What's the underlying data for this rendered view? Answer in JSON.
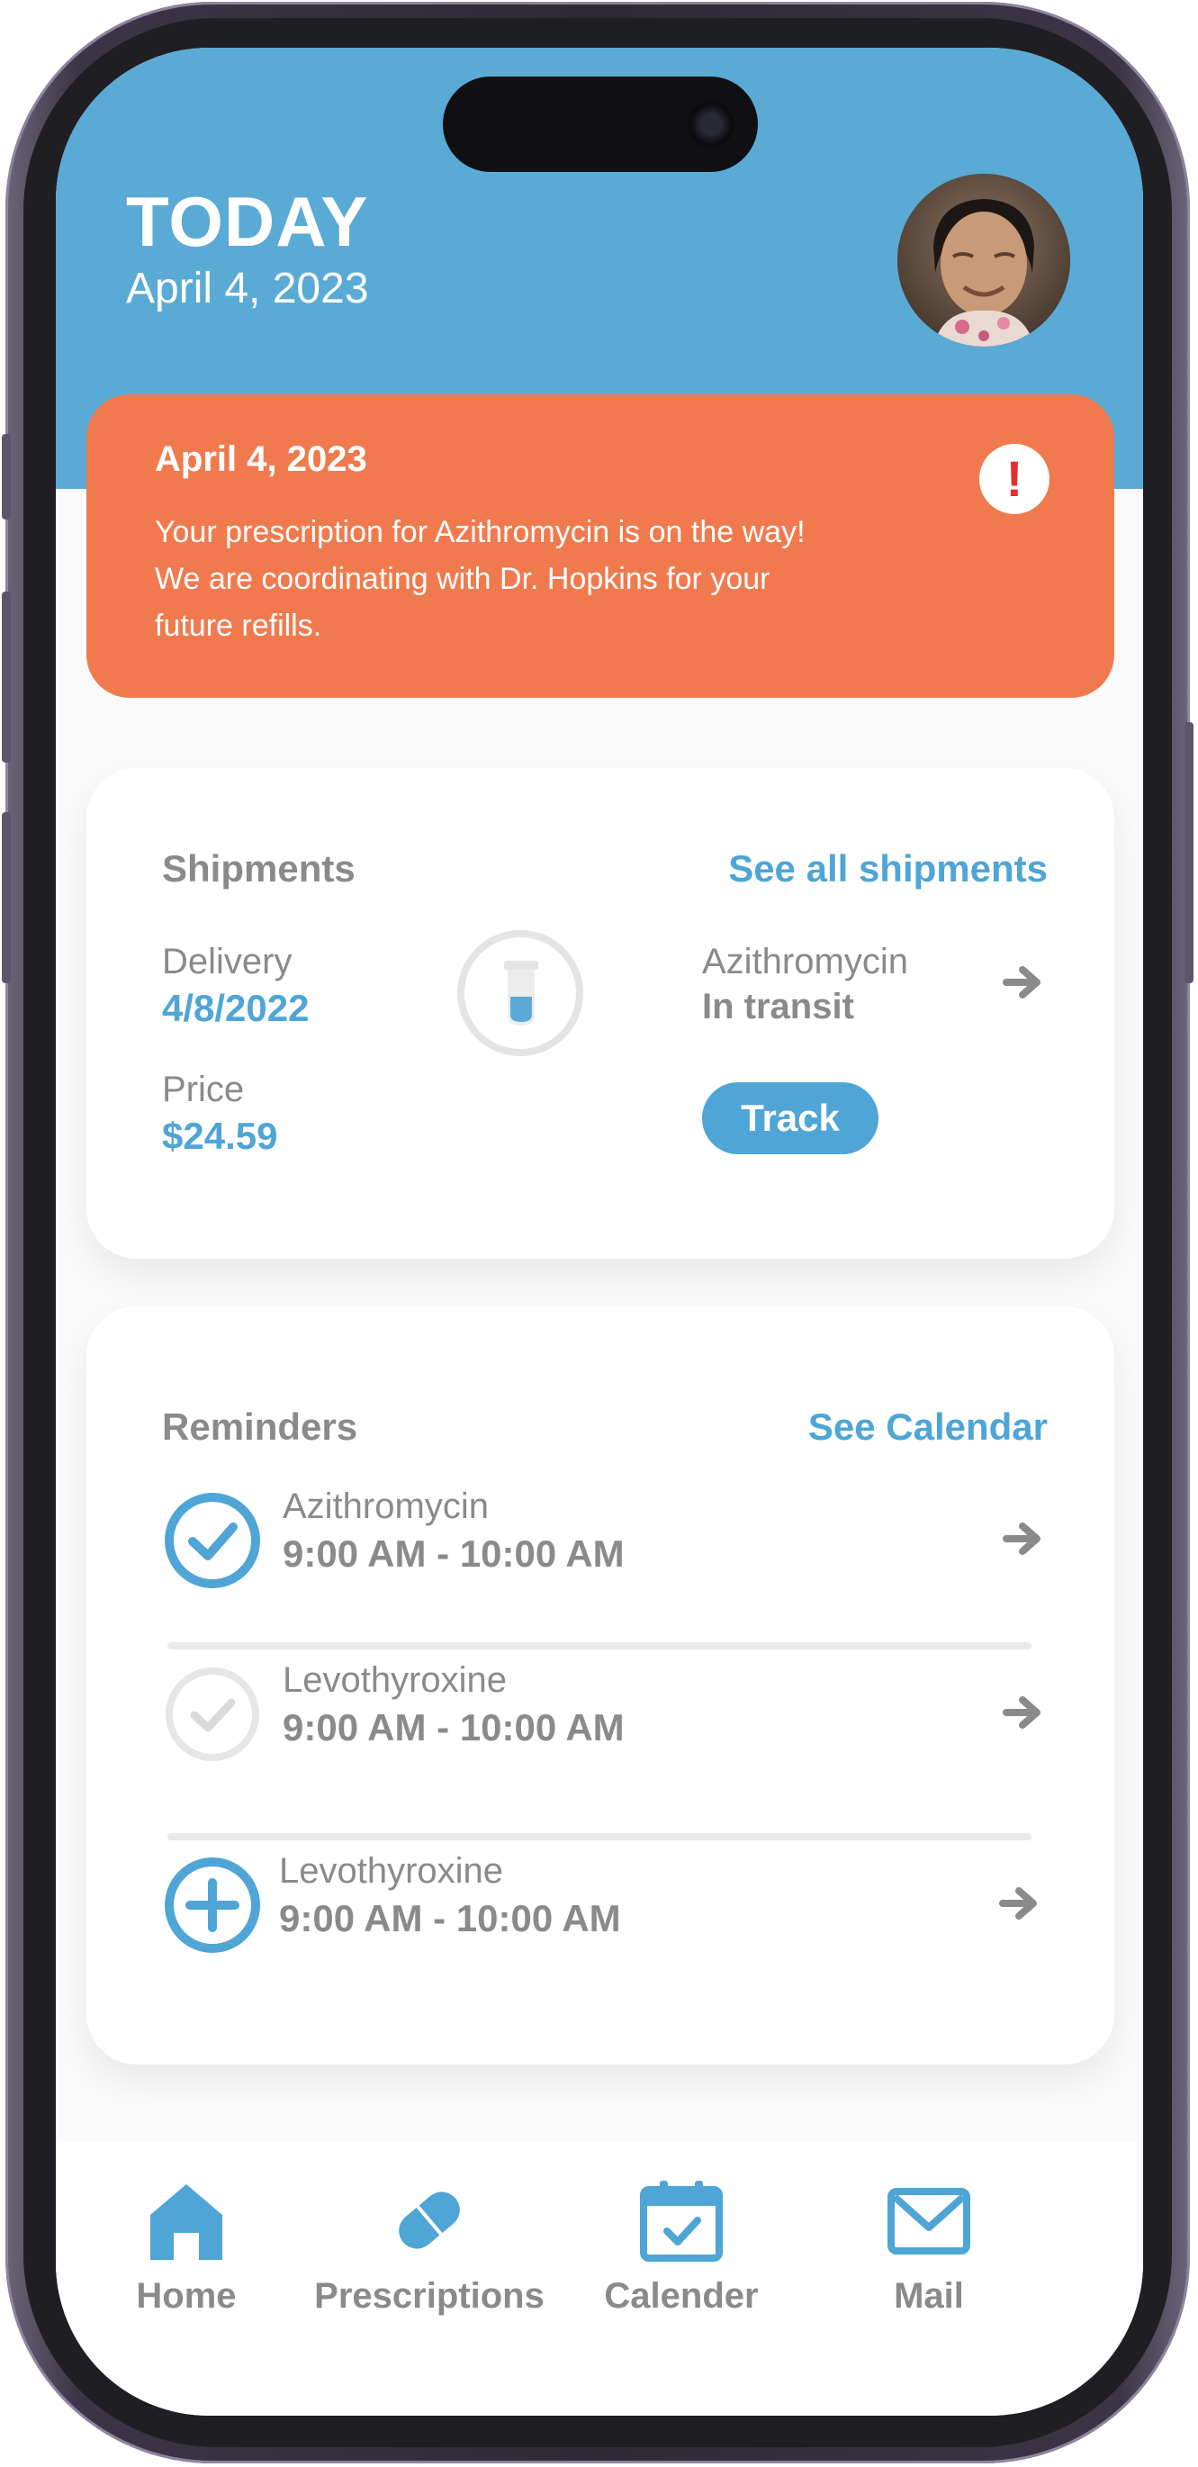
{
  "header": {
    "title": "TODAY",
    "date": "April 4, 2023"
  },
  "alert": {
    "date": "April 4, 2023",
    "message_line1": "Your prescription for Azithromycin is on the way!",
    "message_line2": "We are coordinating with Dr. Hopkins for your",
    "message_line3": "future refills.",
    "icon": "exclamation-icon",
    "color": "#f07a4e"
  },
  "shipments": {
    "title": "Shipments",
    "see_all": "See all shipments",
    "delivery_label": "Delivery",
    "delivery_value": "4/8/2022",
    "price_label": "Price",
    "price_value": "$24.59",
    "medication": "Azithromycin",
    "status": "In transit",
    "track_label": "Track"
  },
  "reminders": {
    "title": "Reminders",
    "see_calendar": "See Calendar",
    "items": [
      {
        "name": "Azithromycin",
        "time": "9:00 AM - 10:00 AM",
        "state": "checked"
      },
      {
        "name": "Levothyroxine",
        "time": "9:00 AM - 10:00 AM",
        "state": "unchecked"
      },
      {
        "name": "Levothyroxine",
        "time": "9:00 AM - 10:00 AM",
        "state": "add"
      }
    ]
  },
  "tabbar": {
    "items": [
      {
        "label": "Home",
        "icon": "home-icon"
      },
      {
        "label": "Prescriptions",
        "icon": "pill-icon"
      },
      {
        "label": "Calender",
        "icon": "calendar-icon"
      },
      {
        "label": "Mail",
        "icon": "mail-icon"
      }
    ]
  },
  "colors": {
    "header": "#5aaad6",
    "accent": "#4ea5d6",
    "text_gray": "#8a8a8a"
  }
}
